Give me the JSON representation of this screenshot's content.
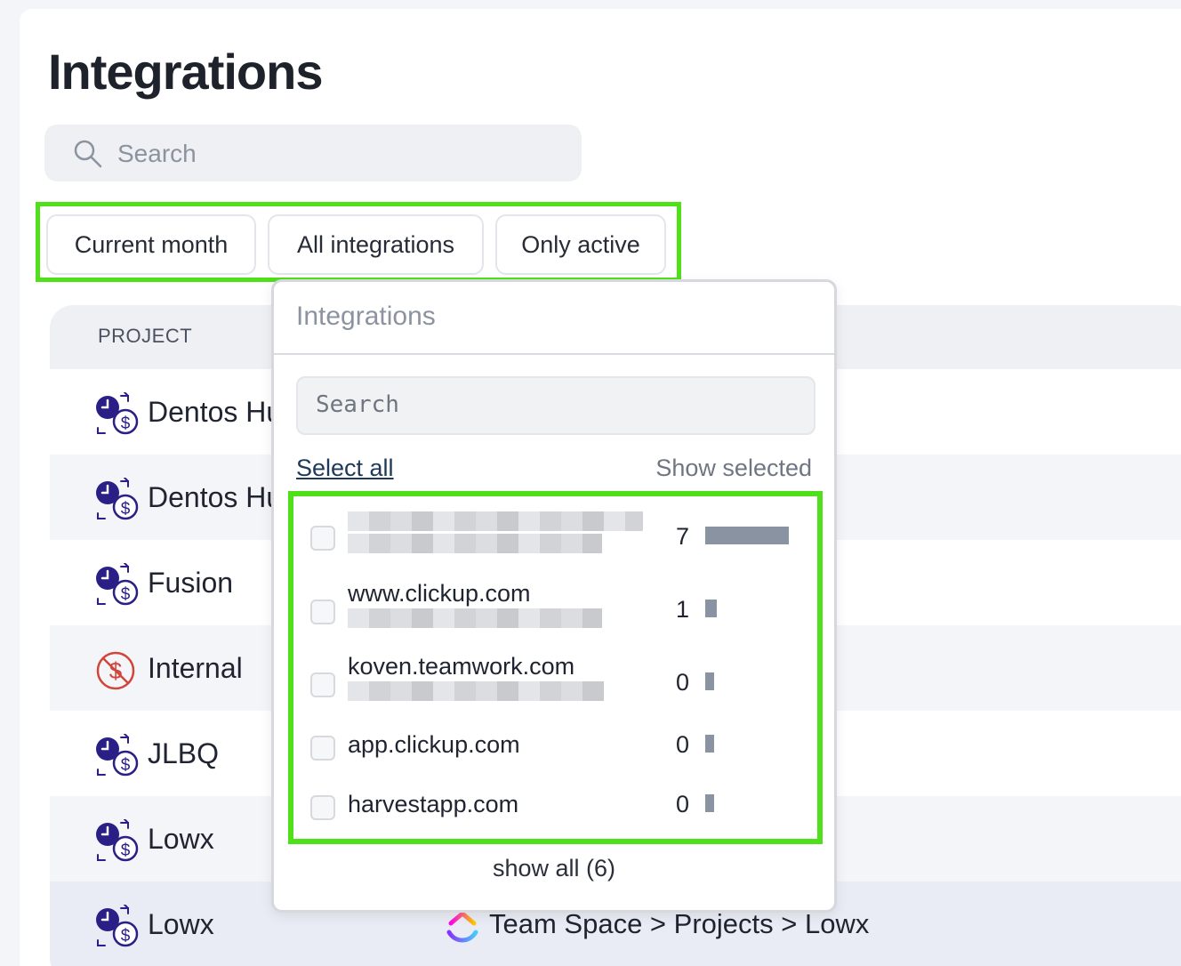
{
  "page": {
    "title": "Integrations"
  },
  "search": {
    "placeholder": "Search"
  },
  "filters": [
    {
      "label": "Current month"
    },
    {
      "label": "All integrations"
    },
    {
      "label": "Only active"
    }
  ],
  "table": {
    "columns": {
      "project": "PROJECT"
    },
    "rows": [
      {
        "project": "Dentos Hu",
        "icon": "clock-dollar-icon"
      },
      {
        "project": "Dentos Hu",
        "icon": "clock-dollar-icon"
      },
      {
        "project": "Fusion",
        "icon": "clock-dollar-icon"
      },
      {
        "project": "Internal",
        "icon": "no-billing-icon"
      },
      {
        "project": "JLBQ",
        "icon": "clock-dollar-icon"
      },
      {
        "project": "Lowx",
        "icon": "clock-dollar-icon"
      },
      {
        "project": "Lowx",
        "icon": "clock-dollar-icon",
        "integration_path": "Team Space > Projects > Lowx",
        "integration_icon": "clickup-logo-icon"
      }
    ]
  },
  "dropdown": {
    "title": "Integrations",
    "search_placeholder": "Search",
    "select_all": "Select all",
    "show_selected": "Show selected",
    "items": [
      {
        "name": "",
        "count": "7",
        "bar_fraction": 1.0
      },
      {
        "name": "www.clickup.com",
        "count": "1",
        "bar_fraction": 0.14
      },
      {
        "name": "koven.teamwork.com",
        "count": "0",
        "bar_fraction": 0
      },
      {
        "name": "app.clickup.com",
        "count": "0",
        "bar_fraction": 0
      },
      {
        "name": "harvestapp.com",
        "count": "0",
        "bar_fraction": 0
      }
    ],
    "show_all": "show all (6)"
  },
  "colors": {
    "highlight": "#4fe01a",
    "icon_primary": "#2a1f86",
    "no_billing": "#d0463c",
    "bar": "#8a93a2"
  }
}
